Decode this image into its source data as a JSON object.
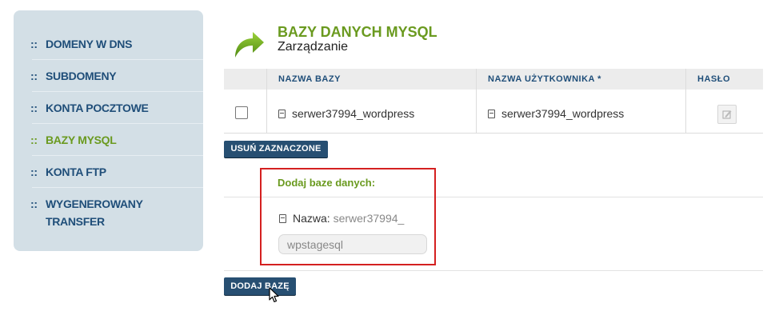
{
  "sidebar": {
    "items": [
      {
        "bullet": "::",
        "label": "DOMENY W DNS"
      },
      {
        "bullet": "::",
        "label": "SUBDOMENY"
      },
      {
        "bullet": "::",
        "label": "KONTA POCZTOWE"
      },
      {
        "bullet": "::",
        "label": "BAZY MYSQL",
        "active": true
      },
      {
        "bullet": "::",
        "label": "KONTA FTP"
      },
      {
        "bullet": "::",
        "label": "WYGENEROWANY",
        "label_line2": "TRANSFER"
      }
    ]
  },
  "header": {
    "title": "BAZY DANYCH MYSQL",
    "subtitle": "Zarządzanie",
    "icon": "green-arrow-icon"
  },
  "table": {
    "columns": [
      "NAZWA BAZY",
      "NAZWA UŻYTKOWNIKA *",
      "HASŁO"
    ],
    "rows": [
      {
        "checked": false,
        "db_name": "serwer37994_wordpress",
        "user_name": "serwer37994_wordpress",
        "password_icon": "edit-icon"
      }
    ]
  },
  "actions": {
    "delete_selected": "USUŃ ZAZNACZONE",
    "add_db": "DODAJ BAZĘ"
  },
  "add_form": {
    "title": "Dodaj baze danych:",
    "name_label": "Nazwa:",
    "name_prefix": "serwer37994_",
    "input_value": "wpstagesql"
  },
  "colors": {
    "accent_green": "#6a9a1f",
    "nav_blue": "#1f4e79",
    "button_blue": "#274f72",
    "highlight_red": "#d42020",
    "sidebar_bg": "#d3dfe6"
  }
}
